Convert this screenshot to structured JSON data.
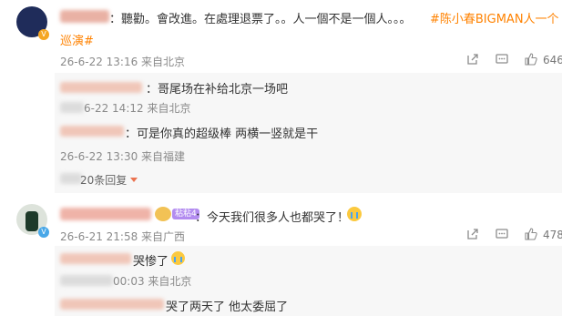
{
  "comment1": {
    "text_main": "：聽勸。會改進。在處理退票了。。人一個不是一個人。。。",
    "hashtag": "#陈小春BIGMAN人一个",
    "hashtag2": "巡演#",
    "meta": "26-6-22 13:16 来自北京",
    "likes": "646"
  },
  "reply1": {
    "text": "：哥尾场在补给北京一场吧",
    "meta": "6-22 14:12 来自北京"
  },
  "reply2": {
    "text": "：可是你真的超级棒 两横一竖就是干",
    "meta": "26-6-22 13:30 来自福建"
  },
  "more_replies": "20条回复",
  "comment2": {
    "badge": "粘粘4",
    "text": "：今天我们很多人也都哭了！",
    "meta": "26-6-21 21:58 来自广西",
    "likes": "478"
  },
  "reply3": {
    "text": "哭惨了",
    "meta": "00:03 来自北京"
  },
  "reply4": {
    "text": "哭了两天了 他太委屈了"
  },
  "icons": {
    "share": "share-icon",
    "comment": "comment-icon",
    "like": "like-icon",
    "emoji": "crying-emoji-icon"
  }
}
